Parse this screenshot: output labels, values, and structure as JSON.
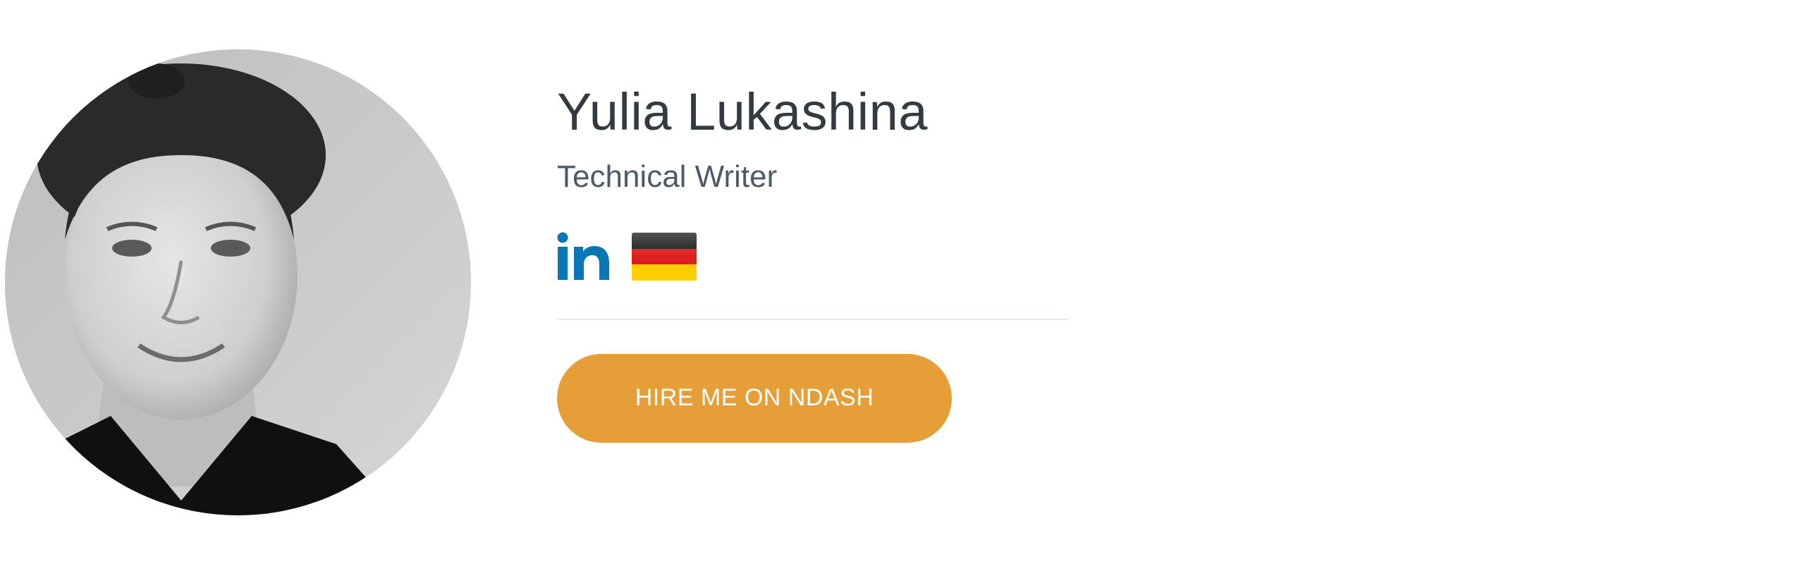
{
  "profile": {
    "name": "Yulia Lukashina",
    "title": "Technical Writer",
    "hire_button_label": "HIRE ME ON NDASH",
    "social_icons": [
      "linkedin-icon",
      "germany-flag-icon"
    ]
  },
  "colors": {
    "name_text": "#333a40",
    "title_text": "#4d5a67",
    "linkedin_blue": "#0a77b5",
    "button_bg": "#e69f38",
    "button_text": "#ffffff",
    "divider": "#e6e9ec",
    "flag_black": "#1a1a1a",
    "flag_red": "#dd1f1f",
    "flag_gold": "#ffce00"
  }
}
